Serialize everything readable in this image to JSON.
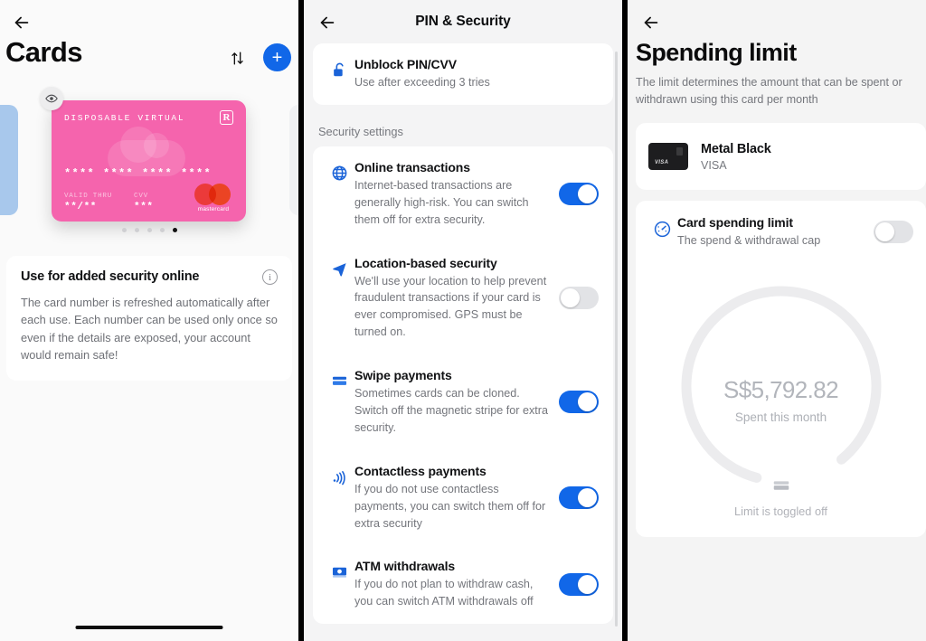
{
  "panel_cards": {
    "back_icon": "arrow-left-icon",
    "title": "Cards",
    "sort_icon": "sort-arrows-icon",
    "add_label": "+",
    "card": {
      "type_label": "DISPOSABLE VIRTUAL",
      "brand_mark": "R",
      "number_groups": [
        "****",
        "****",
        "****",
        "****"
      ],
      "valid_label": "VALID THRU",
      "valid_value": "**/**",
      "cvv_label": "CVV",
      "cvv_value": "***",
      "network": "mastercard",
      "color": "#f564ad"
    },
    "eye_icon": "eye-icon",
    "dots_total": 5,
    "dots_active": 5,
    "info_card": {
      "title": "Use for added security online",
      "info_icon": "info-icon",
      "body": "The card number is refreshed automatically after each use. Each number can be used only once so even if the details are exposed, your account would remain safe!"
    }
  },
  "panel_security": {
    "back_icon": "arrow-left-icon",
    "title": "PIN & Security",
    "unblock": {
      "icon": "unlock-icon",
      "title": "Unblock PIN/CVV",
      "subtitle": "Use after exceeding 3 tries"
    },
    "section_label": "Security settings",
    "settings": [
      {
        "icon": "globe-icon",
        "title": "Online transactions",
        "subtitle": "Internet-based transactions are generally high-risk. You can switch them off for extra security.",
        "toggle": "on"
      },
      {
        "icon": "location-arrow-icon",
        "title": "Location-based security",
        "subtitle": "We'll use your location to help prevent fraudulent transactions if your card is ever compromised. GPS must be turned on.",
        "toggle": "off"
      },
      {
        "icon": "credit-card-icon",
        "title": "Swipe payments",
        "subtitle": "Sometimes cards can be cloned. Switch off the magnetic stripe for extra security.",
        "toggle": "on"
      },
      {
        "icon": "contactless-icon",
        "title": "Contactless payments",
        "subtitle": "If you do not use contactless payments, you can switch them off for extra security",
        "toggle": "on"
      },
      {
        "icon": "banknote-icon",
        "title": "ATM withdrawals",
        "subtitle": "If you do not plan to withdraw cash, you can switch ATM withdrawals off",
        "toggle": "on"
      }
    ]
  },
  "panel_limit": {
    "back_icon": "arrow-left-icon",
    "title": "Spending limit",
    "subtitle": "The limit determines the amount that can be spent or withdrawn using this card per month",
    "card_selector": {
      "name": "Metal Black",
      "brand": "VISA"
    },
    "limit_row": {
      "icon": "gauge-icon",
      "title": "Card spending limit",
      "subtitle": "The spend & withdrawal cap",
      "toggle": "off"
    },
    "gauge": {
      "amount": "S$5,792.82",
      "caption": "Spent this month",
      "center_icon": "credit-card-icon",
      "status": "Limit is toggled off"
    }
  },
  "theme": {
    "accent": "#1167e8",
    "card_pink": "#f564ad",
    "text_primary": "#111214",
    "text_secondary": "#74767c"
  }
}
